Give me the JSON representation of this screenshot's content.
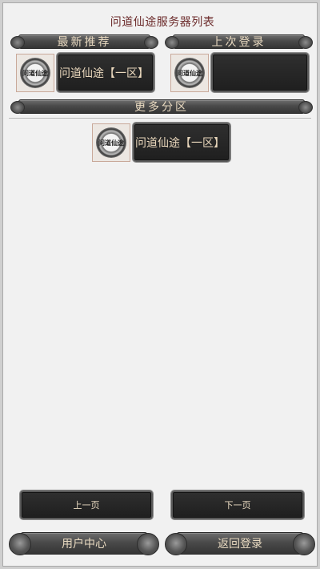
{
  "title": "问道仙途服务器列表",
  "sections": {
    "recommended": "最新推荐",
    "last_login": "上次登录",
    "more_zones": "更多分区"
  },
  "logo_text": "问道仙途",
  "recommended_server": {
    "name": "问道仙途【一区】"
  },
  "last_login_server": {
    "name": ""
  },
  "more_servers": [
    {
      "name": "问道仙途【一区】"
    }
  ],
  "pagination": {
    "prev": "上一页",
    "next": "下一页"
  },
  "footer": {
    "user_center": "用户中心",
    "back_login": "返回登录"
  }
}
